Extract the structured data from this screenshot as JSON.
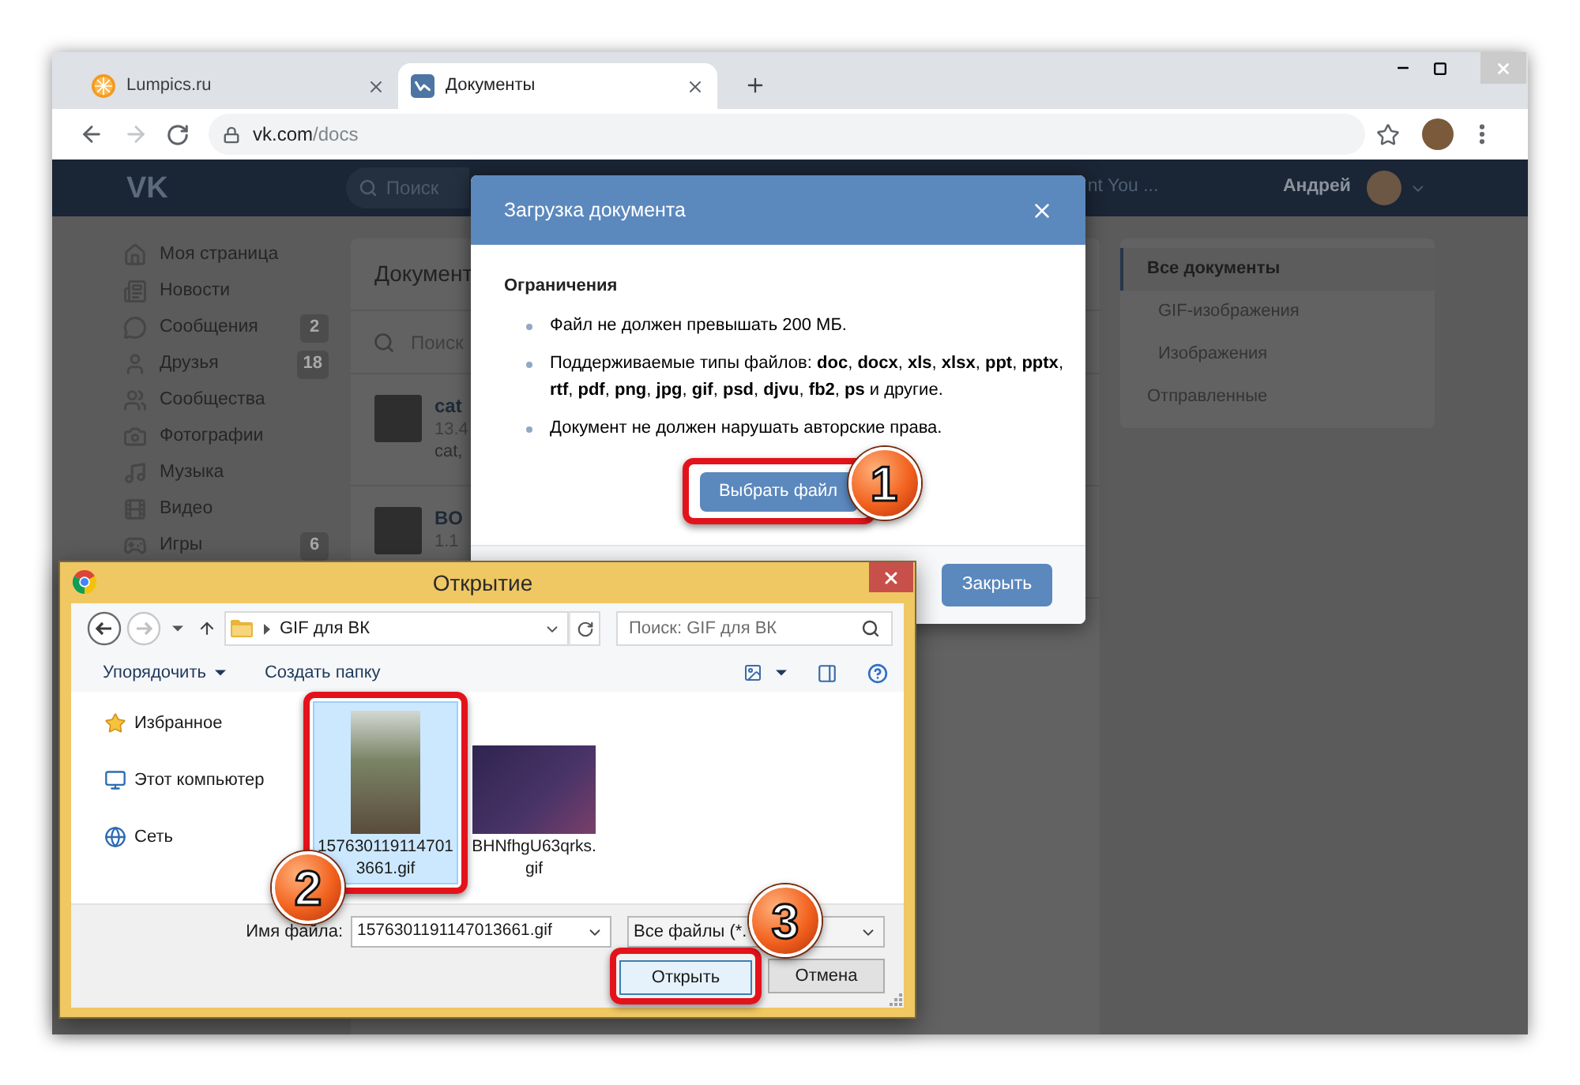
{
  "browser": {
    "tabs": [
      {
        "title": "Lumpics.ru",
        "kind": "citrus",
        "selected": false
      },
      {
        "title": "Документы",
        "kind": "vk",
        "selected": true
      }
    ],
    "address": {
      "host": "vk.com",
      "path": "/docs"
    }
  },
  "vk": {
    "header": {
      "logo": "VK",
      "search_placeholder": "Поиск",
      "now_playing": "nt You ...",
      "user_name": "Андрей"
    },
    "menu": [
      {
        "label": "Моя страница",
        "kind": "home"
      },
      {
        "label": "Новости",
        "kind": "news"
      },
      {
        "label": "Сообщения",
        "kind": "messages",
        "count": "2"
      },
      {
        "label": "Друзья",
        "kind": "friends",
        "count": "18"
      },
      {
        "label": "Сообщества",
        "kind": "groups"
      },
      {
        "label": "Фотографии",
        "kind": "photos"
      },
      {
        "label": "Музыка",
        "kind": "music"
      },
      {
        "label": "Видео",
        "kind": "video"
      },
      {
        "label": "Игры",
        "kind": "games",
        "count": "6"
      }
    ],
    "documents": {
      "title": "Документ",
      "search_placeholder": "Поиск",
      "items": [
        {
          "name": "cat",
          "size": "13.4",
          "tags": "cat,"
        },
        {
          "name": "BO",
          "size": "1.1"
        }
      ]
    },
    "filters": [
      {
        "label": "Все документы",
        "selected": true,
        "children": [
          {
            "label": "GIF-изображения",
            "selected": false
          },
          {
            "label": "Изображения",
            "selected": false
          }
        ]
      },
      {
        "label": "Отправленные",
        "selected": false
      }
    ]
  },
  "upload_modal": {
    "title": "Загрузка документа",
    "section": "Ограничения",
    "rules": [
      "Файл не должен превышать 200 МБ.",
      "Поддерживаемые типы файлов: **doc**, **docx**, **xls**, **xlsx**, **ppt**, **pptx**, **rtf**, **pdf**, **png**, **jpg**, **gif**, **psd**, **djvu**, **fb2**, **ps** и другие.",
      "Документ не должен нарушать авторские права."
    ],
    "choose_button": {
      "label": "Выбрать файл",
      "highlighted": true,
      "step": "1"
    },
    "close_button": "Закрыть"
  },
  "open_dialog": {
    "title": "Открытие",
    "location": "GIF для ВК",
    "search_placeholder": "Поиск: GIF для ВК",
    "organize": "Упорядочить",
    "new_folder": "Создать папку",
    "places": [
      {
        "label": "Избранное",
        "kind": "favorites"
      },
      {
        "label": "Этот компьютер",
        "kind": "computer"
      },
      {
        "label": "Сеть",
        "kind": "network"
      }
    ],
    "files": [
      {
        "name": "1576301191147013661.gif",
        "selected": true,
        "highlighted": true,
        "step": "2"
      },
      {
        "name": "BHNfhgU63qrks.gif",
        "selected": false,
        "highlighted": false
      }
    ],
    "file_name_label": "Имя файла:",
    "file_name": "1576301191147013661.gif",
    "file_type": "Все файлы (*.",
    "open_button": {
      "label": "Открыть",
      "highlighted": true,
      "step": "3"
    },
    "cancel_button": "Отмена"
  }
}
